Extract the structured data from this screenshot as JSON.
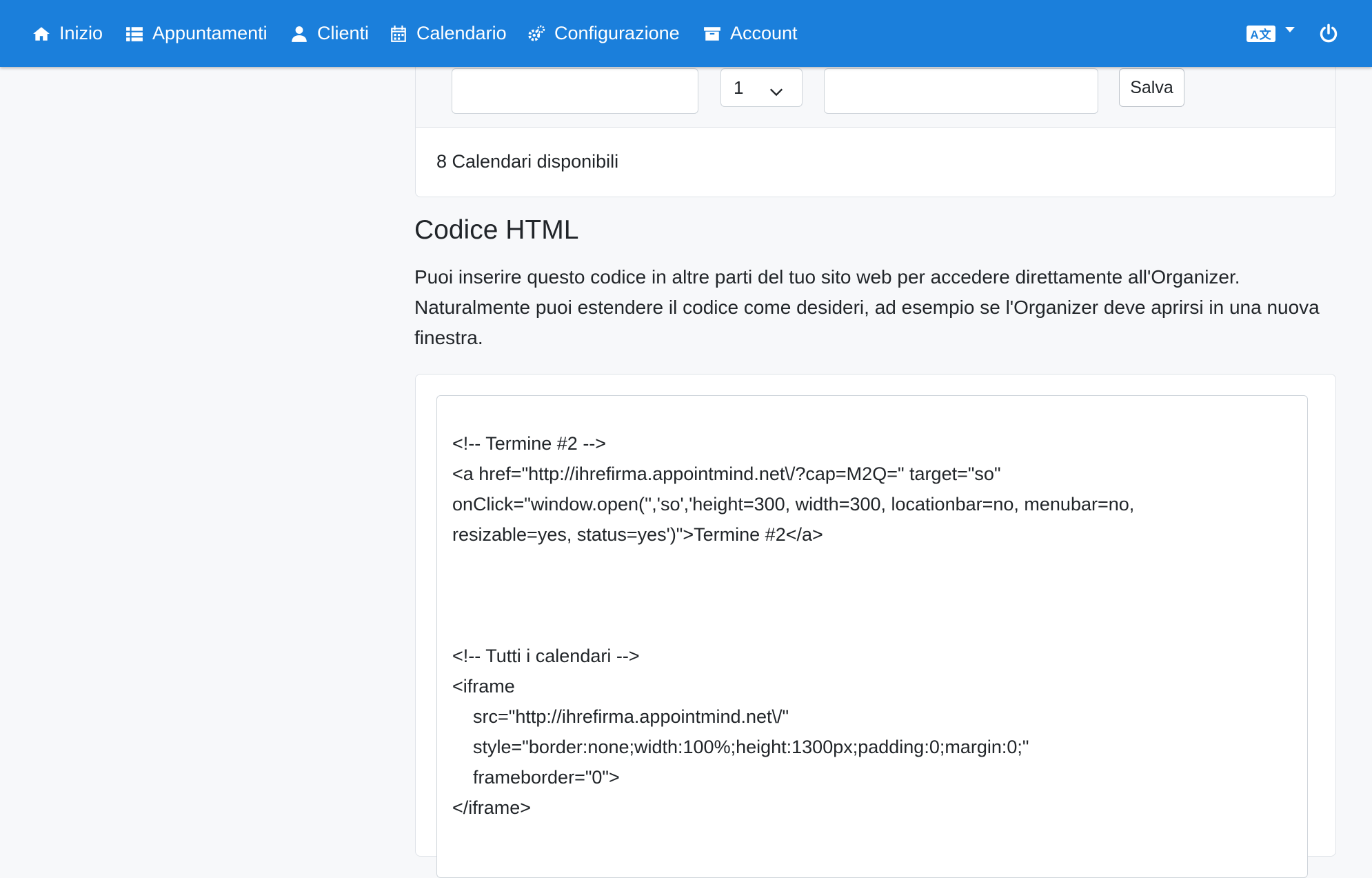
{
  "nav": {
    "items": [
      {
        "label": "Inizio",
        "icon": "home-icon"
      },
      {
        "label": "Appuntamenti",
        "icon": "list-icon"
      },
      {
        "label": "Clienti",
        "icon": "user-icon"
      },
      {
        "label": "Calendario",
        "icon": "calendar-icon"
      },
      {
        "label": "Configurazione",
        "icon": "cogs-icon"
      },
      {
        "label": "Account",
        "icon": "archive-icon"
      }
    ],
    "language_badge": "A文",
    "language_icon": "language-icon",
    "power_icon": "power-icon",
    "accent_color": "#1b7fdb"
  },
  "form": {
    "name_value": "",
    "select_value": "1",
    "extra_value": "",
    "save_label": "Salva"
  },
  "calendars_available": "8 Calendari disponibili",
  "section": {
    "title": "Codice HTML",
    "description": "Puoi inserire questo codice in altre parti del tuo sito web per accedere direttamente all'Organizer. Naturalmente puoi estendere il codice come desideri, ad esempio se l'Organizer deve aprirsi in una nuova finestra."
  },
  "code": {
    "lines": [
      "<!-- Termine #2 -->",
      "<a href=\"http://ihrefirma.appointmind.net\\/?cap=M2Q=\" target=\"so\"",
      "onClick=\"window.open('','so','height=300, width=300, locationbar=no, menubar=no,",
      "resizable=yes, status=yes')\">Termine #2</a>",
      "",
      "",
      "",
      "<!-- Tutti i calendari -->",
      "<iframe",
      "    src=\"http://ihrefirma.appointmind.net\\/\"",
      "    style=\"border:none;width:100%;height:1300px;padding:0;margin:0;\"",
      "    frameborder=\"0\">",
      "</iframe>"
    ]
  }
}
